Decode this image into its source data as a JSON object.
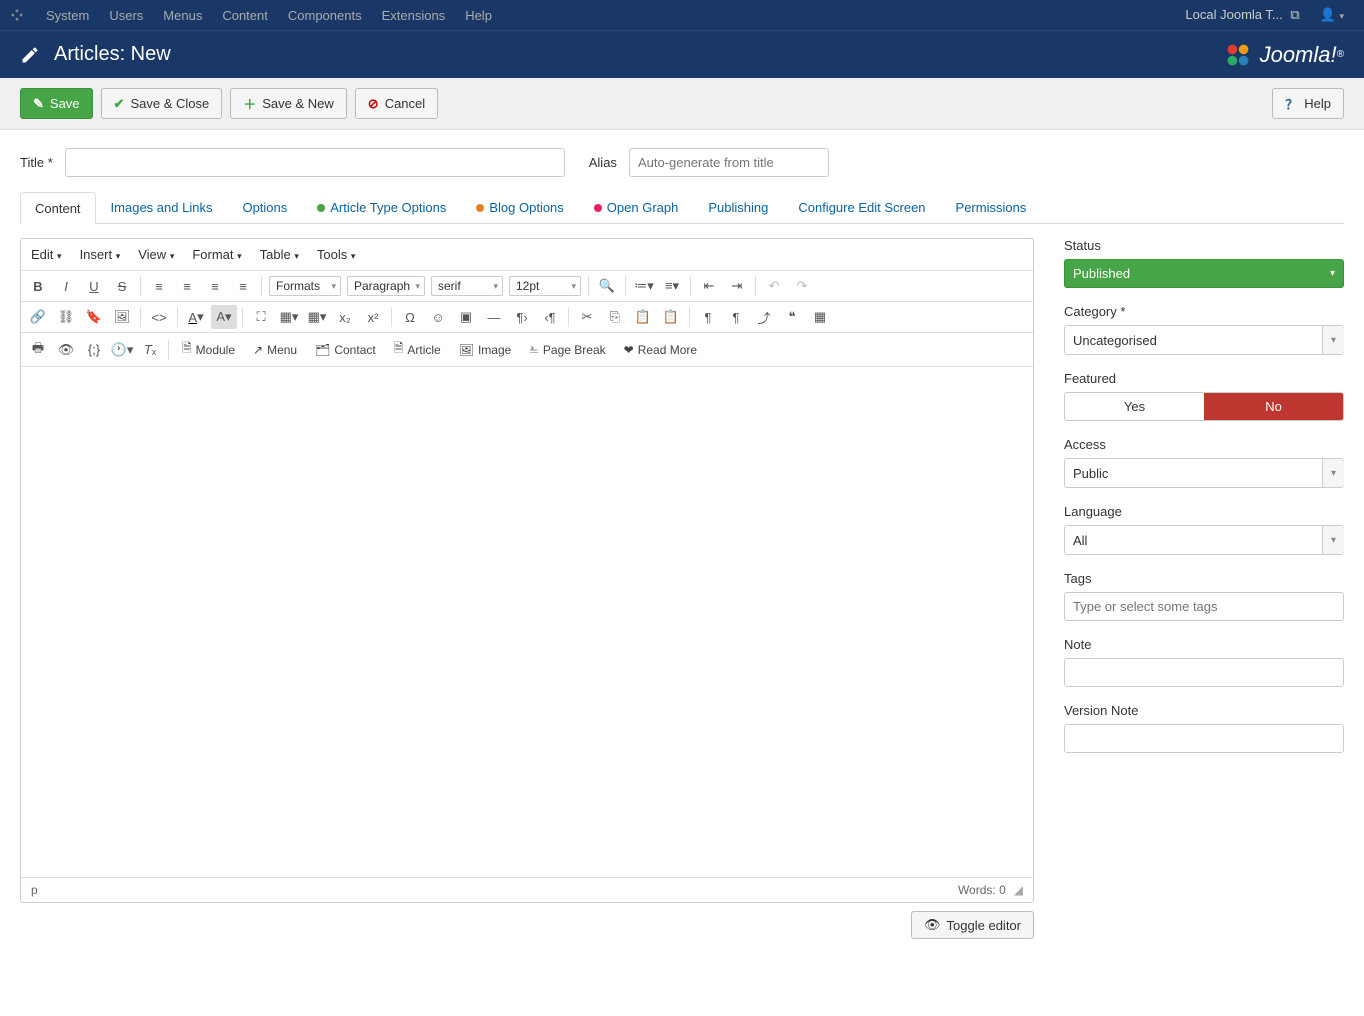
{
  "adminBar": {
    "menu": [
      "System",
      "Users",
      "Menus",
      "Content",
      "Components",
      "Extensions",
      "Help"
    ],
    "siteLink": "Local Joomla T..."
  },
  "header": {
    "title": "Articles: New",
    "brand": "Joomla!"
  },
  "toolbar": {
    "save": "Save",
    "saveClose": "Save & Close",
    "saveNew": "Save & New",
    "cancel": "Cancel",
    "help": "Help"
  },
  "fields": {
    "titleLabel": "Title *",
    "aliasLabel": "Alias",
    "aliasPlaceholder": "Auto-generate from title"
  },
  "tabs": [
    "Content",
    "Images and Links",
    "Options",
    "Article Type Options",
    "Blog Options",
    "Open Graph",
    "Publishing",
    "Configure Edit Screen",
    "Permissions"
  ],
  "editor": {
    "menus": [
      "Edit",
      "Insert",
      "View",
      "Format",
      "Table",
      "Tools"
    ],
    "formats": "Formats",
    "paragraph": "Paragraph",
    "fontfamily": "serif",
    "fontsize": "12pt",
    "extra": {
      "module": "Module",
      "menu": "Menu",
      "contact": "Contact",
      "article": "Article",
      "image": "Image",
      "pagebreak": "Page Break",
      "readmore": "Read More"
    },
    "statusPath": "p",
    "wordsLabel": "Words:",
    "wordsCount": "0",
    "toggle": "Toggle editor"
  },
  "sidebar": {
    "status": {
      "label": "Status",
      "value": "Published"
    },
    "category": {
      "label": "Category *",
      "value": "Uncategorised"
    },
    "featured": {
      "label": "Featured",
      "yes": "Yes",
      "no": "No"
    },
    "access": {
      "label": "Access",
      "value": "Public"
    },
    "language": {
      "label": "Language",
      "value": "All"
    },
    "tags": {
      "label": "Tags",
      "placeholder": "Type or select some tags"
    },
    "note": {
      "label": "Note"
    },
    "versionNote": {
      "label": "Version Note"
    }
  }
}
